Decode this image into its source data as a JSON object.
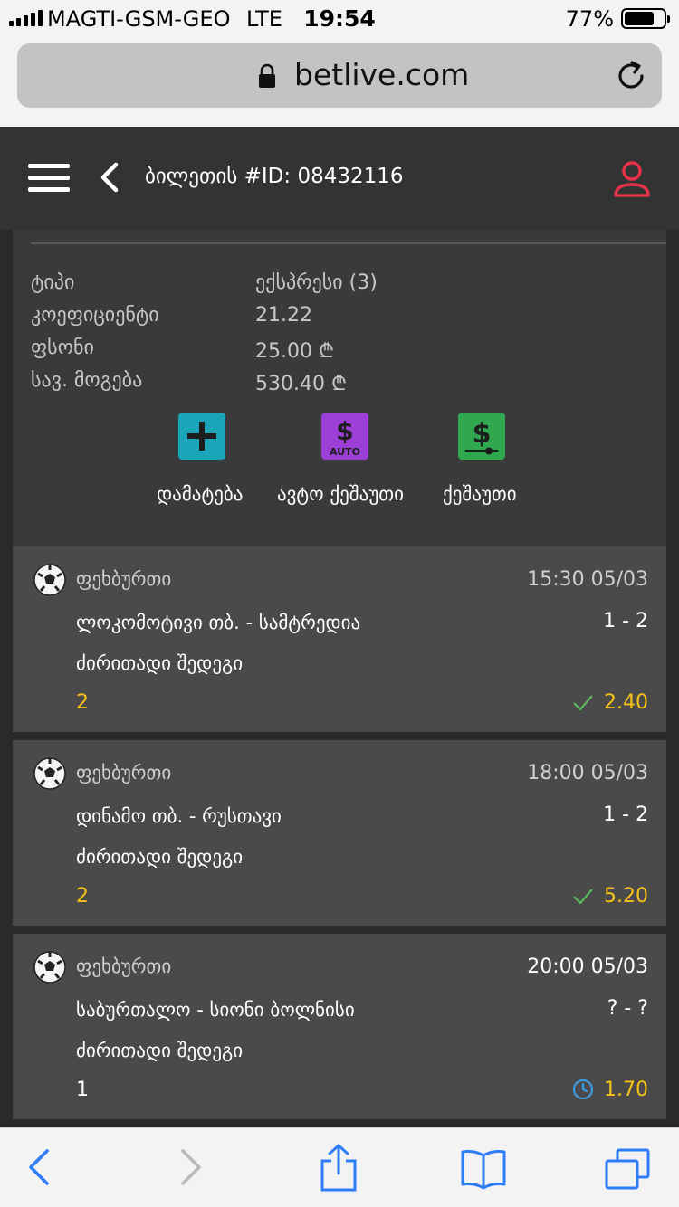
{
  "status_bar": {
    "carrier": "MAGTI-GSM-GEO",
    "network": "LTE",
    "time": "19:54",
    "battery": "77%",
    "battery_level": 0.77
  },
  "browser": {
    "url": "betlive.com"
  },
  "header": {
    "title": "ბილეთის #ID: 08432116",
    "accent_color": "#e8324a"
  },
  "summary": {
    "rows": [
      {
        "label": "ტიპი",
        "value": "ექსპრესი (3)"
      },
      {
        "label": "კოეფიციენტი",
        "value": "21.22"
      },
      {
        "label": "ფსონი",
        "value": "25.00 ₾"
      },
      {
        "label": "სავ. მოგება",
        "value": "530.40 ₾"
      }
    ],
    "actions": [
      {
        "label": "დამატება",
        "icon": "plus-icon",
        "color": "#1aa5b8"
      },
      {
        "label": "ავტო ქეშაუთი",
        "icon": "auto-cashout-icon",
        "badge": "AUTO",
        "color": "#9b3fd6"
      },
      {
        "label": "ქეშაუთი",
        "icon": "cashout-icon",
        "color": "#2fa84f"
      }
    ]
  },
  "bets": [
    {
      "sport": "ფეხბურთი",
      "datetime": "15:30 05/03",
      "match": "ლოკომოტივი თბ. - სამტრედია",
      "score": "1 - 2",
      "market": "ძირითადი შედეგი",
      "pick": "2",
      "odd": "2.40",
      "status": "won"
    },
    {
      "sport": "ფეხბურთი",
      "datetime": "18:00 05/03",
      "match": "დინამო თბ. - რუსთავი",
      "score": "1 - 2",
      "market": "ძირითადი შედეგი",
      "pick": "2",
      "odd": "5.20",
      "status": "won"
    },
    {
      "sport": "ფეხბურთი",
      "datetime": "20:00 05/03",
      "match": "საბურთალო - სიონი ბოლნისი",
      "score": "? - ?",
      "market": "ძირითადი შედეგი",
      "pick": "1",
      "odd": "1.70",
      "status": "pending"
    }
  ],
  "colors": {
    "won": "#5cb85c",
    "pending": "#3b9be0",
    "odd": "#f5c217",
    "browser_blue": "#2e7cf6"
  }
}
